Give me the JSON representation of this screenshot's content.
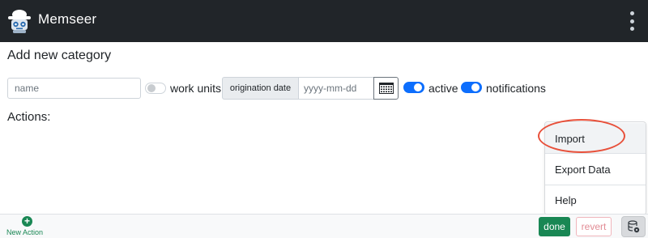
{
  "app": {
    "title": "Memseer"
  },
  "page": {
    "title": "Add new category"
  },
  "form": {
    "name_placeholder": "name",
    "work_units_label": "work units",
    "work_units_on": false,
    "origination_date_label": "origination date",
    "origination_date_placeholder": "yyyy-mm-dd",
    "active_label": "active",
    "active_on": true,
    "notifications_label": "notifications",
    "notifications_on": true
  },
  "actions": {
    "heading": "Actions:"
  },
  "menu": {
    "items": [
      {
        "label": "Import",
        "highlighted": true
      },
      {
        "label": "Export Data"
      },
      {
        "label": "Help"
      }
    ]
  },
  "footer": {
    "new_action_label": "New Action",
    "done_label": "done",
    "revert_label": "revert"
  },
  "icons": {
    "logo": "robot-logo-icon",
    "menu": "kebab-menu-icon",
    "calendar": "calendar-icon",
    "add": "plus-circle-icon",
    "database": "database-settings-icon"
  },
  "colors": {
    "header_bg": "#212529",
    "primary": "#0d6efd",
    "success": "#198754",
    "danger_light": "#e28c95",
    "highlight_ring": "#e8503a"
  }
}
